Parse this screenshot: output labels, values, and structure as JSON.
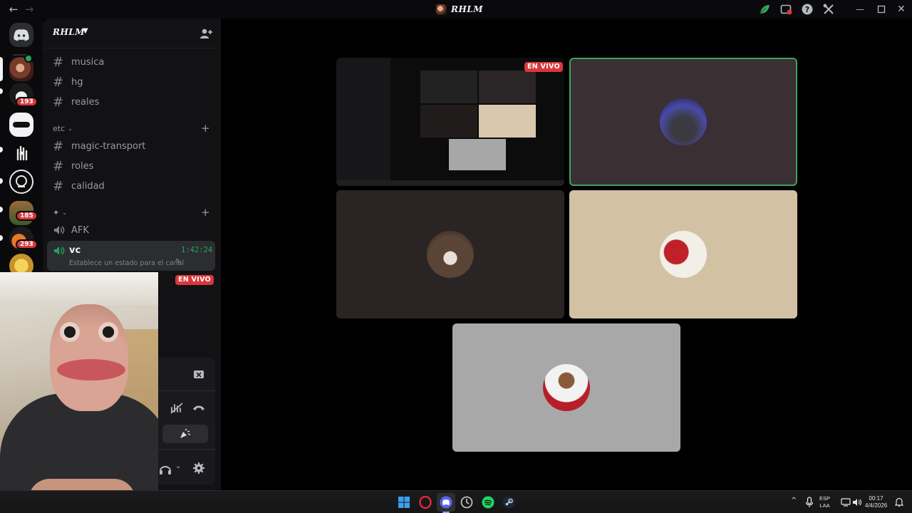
{
  "window": {
    "title": "RHLM",
    "back_icon": "arrow-left-icon",
    "forward_icon": "arrow-right-icon"
  },
  "titlebar_actions": [
    {
      "name": "leaf-icon"
    },
    {
      "name": "inbox-icon"
    },
    {
      "name": "help-icon"
    },
    {
      "name": "tools-icon"
    },
    {
      "name": "minimize-icon"
    },
    {
      "name": "maximize-icon"
    },
    {
      "name": "close-icon"
    }
  ],
  "server_rail": {
    "badges": [
      "193",
      "185",
      "293"
    ]
  },
  "server": {
    "name": "RHLM"
  },
  "channels_top": [
    {
      "name": "musica"
    },
    {
      "name": "hg"
    },
    {
      "name": "reales"
    }
  ],
  "category_etc": {
    "label": "etc",
    "channels": [
      {
        "name": "magic-transport"
      },
      {
        "name": "roles"
      },
      {
        "name": "calidad"
      }
    ]
  },
  "category_voice": {
    "label": "✦",
    "channels": [
      {
        "name": "AFK"
      }
    ]
  },
  "active_voice": {
    "name": "vc",
    "timer": "1:42:24",
    "status_placeholder": "Establece un estado para el canal"
  },
  "live_label": "EN VIVO",
  "taskbar": {
    "lang_top": "ESP",
    "lang_bottom": "LAA",
    "time": "00:17",
    "date": "4/4/2026"
  },
  "colors": {
    "accent_green": "#23a55a",
    "live_red": "#da373c",
    "speaking_border": "#3ba55d"
  }
}
